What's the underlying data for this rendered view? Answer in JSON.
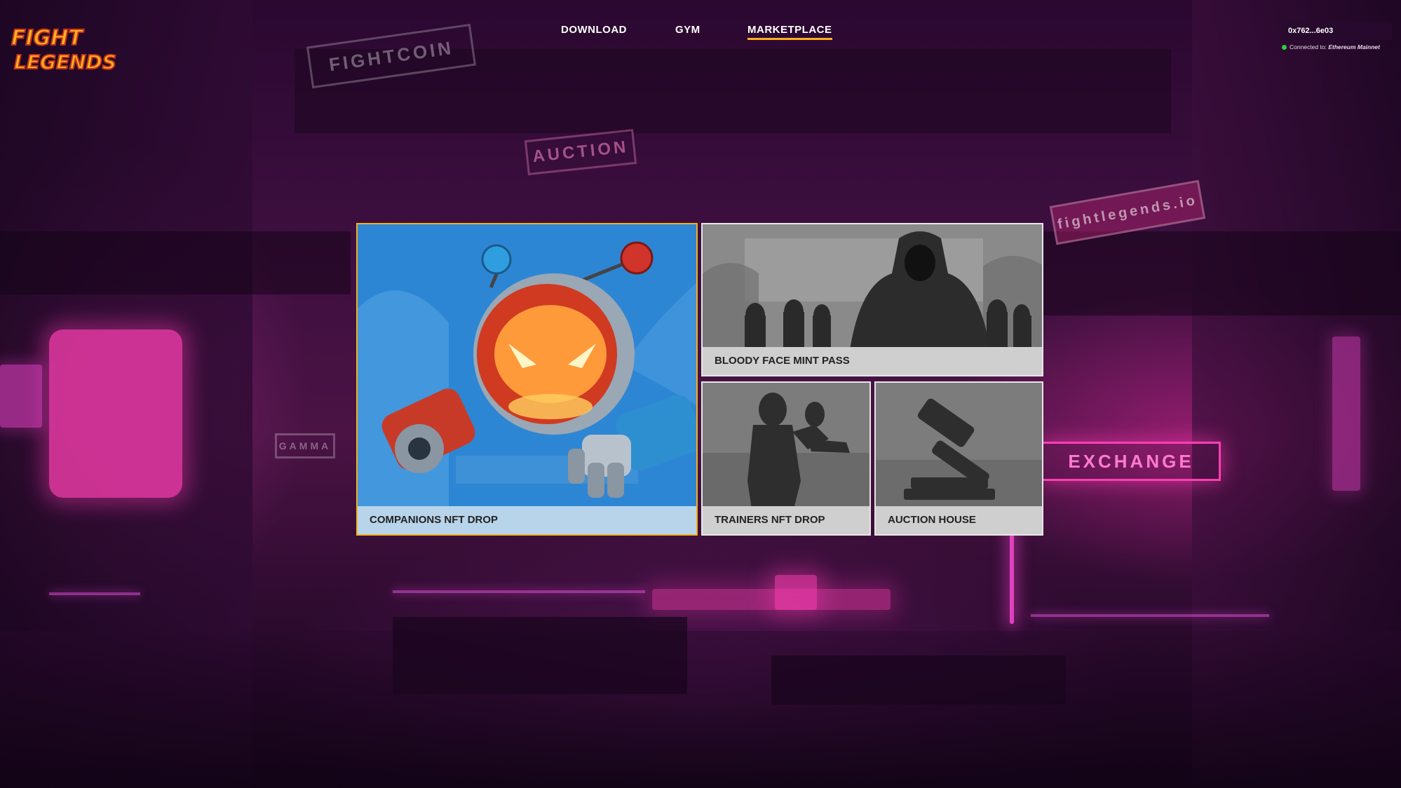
{
  "brand": {
    "logo_line1": "FIGHT",
    "logo_line2": "LEGENDS"
  },
  "nav": {
    "items": [
      {
        "label": "DOWNLOAD",
        "active": false
      },
      {
        "label": "GYM",
        "active": false
      },
      {
        "label": "MARKETPLACE",
        "active": true
      }
    ]
  },
  "wallet": {
    "address": "0x762...6e03",
    "status_prefix": "Connected to:",
    "network": "Ethereum Mainnet",
    "status_color": "#2ecc40"
  },
  "cards": {
    "companions": {
      "label": "COMPANIONS NFT DROP",
      "icon": "robot-companion-icon",
      "selected": true
    },
    "bloody_face": {
      "label": "BLOODY FACE MINT PASS",
      "icon": "hooded-figure-icon"
    },
    "trainers": {
      "label": "TRAINERS NFT DROP",
      "icon": "trainer-silhouette-icon"
    },
    "auction": {
      "label": "AUCTION HOUSE",
      "icon": "gavel-icon"
    }
  },
  "background_signs": {
    "fightcoin": "FIGHTCOIN",
    "auction": "AUCTION",
    "legends_site": "fightlegends.io",
    "gamma": "GAMMA",
    "exchange": "EXCHANGE"
  },
  "colors": {
    "accent": "#ffb020",
    "neon_pink": "#ff3fb3",
    "card_label_bg": "#cfcfcf",
    "companions_label_bg": "#b8d4ea"
  }
}
